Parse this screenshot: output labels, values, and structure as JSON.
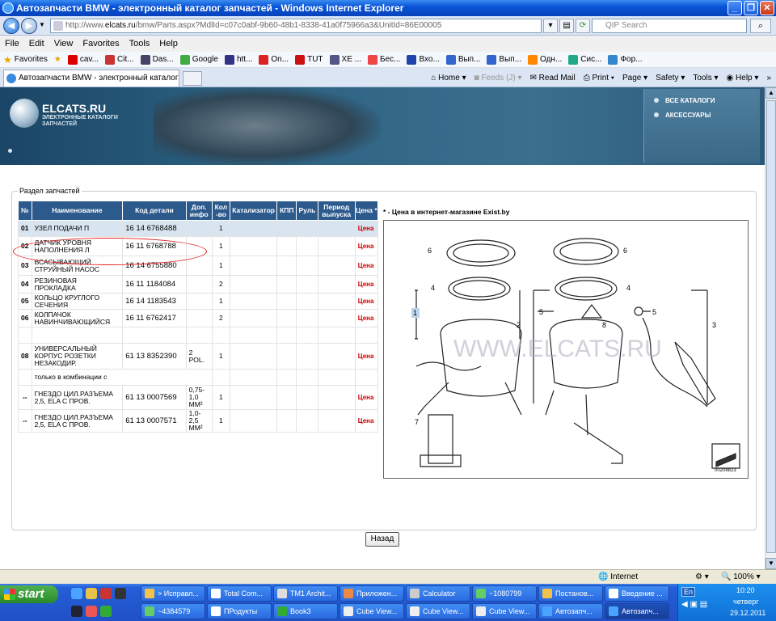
{
  "window": {
    "title": "Автозапчасти BMW - электронный каталог запчастей - Windows Internet Explorer"
  },
  "address": {
    "url_prefix": "http://www.",
    "url_domain": "elcats.ru",
    "url_rest": "/bmw/Parts.aspx?MdlId=c07c0abf-9b60-48b1-8338-41a0f75966a3&UnitId=86E00005",
    "search_placeholder": "QIP Search"
  },
  "menu": [
    "File",
    "Edit",
    "View",
    "Favorites",
    "Tools",
    "Help"
  ],
  "favorites": {
    "label": "Favorites",
    "items": [
      "cav...",
      "Cit...",
      "Das...",
      "Google",
      "htt...",
      "On...",
      "TUT",
      "XE ...",
      "Бес...",
      "Вхо...",
      "Вып...",
      "Вып...",
      "Одн...",
      "Сис...",
      "Фор..."
    ]
  },
  "tab": {
    "label": "Автозапчасти BMW - электронный каталог запчас..."
  },
  "commands": {
    "home": "Home",
    "feeds": "Feeds (J)",
    "mail": "Read Mail",
    "print": "Print",
    "page": "Page",
    "safety": "Safety",
    "tools": "Tools",
    "help": "Help"
  },
  "banner": {
    "logo": "ELCATS.RU",
    "logo_sub": "ЭЛЕКТРОННЫЕ КАТАЛОГИ ЗАПЧАСТЕЙ",
    "link_all": "ВСЕ КАТАЛОГИ",
    "link_acc": "АКСЕССУАРЫ"
  },
  "section": {
    "legend": "Раздел запчастей",
    "note": "* - Цена в интернет-магазине Exist.by",
    "back": "Назад"
  },
  "table": {
    "headers": [
      "№",
      "Наименование",
      "Код детали",
      "Доп. инфо",
      "Кол -во",
      "Катализатор",
      "КПП",
      "Руль",
      "Период выпуска",
      "Цена *"
    ],
    "rows": [
      {
        "num": "01",
        "name": "УЗЕЛ ПОДАЧИ П",
        "code": "16 14 6768488",
        "info": "",
        "qty": "1",
        "price": "Цена"
      },
      {
        "num": "02",
        "name": "ДАТЧИК УРОВНЯ НАПОЛНЕНИЯ Л",
        "code": "16 11 6768788",
        "info": "",
        "qty": "1",
        "price": "Цена"
      },
      {
        "num": "03",
        "name": "ВСАСЫВАЮЩИЙ СТРУЙНЫЙ НАСОС",
        "code": "16 14 6755880",
        "info": "",
        "qty": "1",
        "price": "Цена"
      },
      {
        "num": "04",
        "name": "РЕЗИНОВАЯ ПРОКЛАДКА",
        "code": "16 11 1184084",
        "info": "",
        "qty": "2",
        "price": "Цена"
      },
      {
        "num": "05",
        "name": "КОЛЬЦО КРУГЛОГО СЕЧЕНИЯ",
        "code": "16 14 1183543",
        "info": "",
        "qty": "1",
        "price": "Цена"
      },
      {
        "num": "06",
        "name": "КОЛПАЧОК НАВИНЧИВАЮЩИЙСЯ",
        "code": "16 11 6762417",
        "info": "",
        "qty": "2",
        "price": "Цена"
      },
      {
        "num": "",
        "name": "",
        "code": "",
        "info": "",
        "qty": "",
        "price": ""
      },
      {
        "num": "08",
        "name": "УНИВЕРСАЛЬНЫЙ КОРПУС РОЗЕТКИ НЕЗАКОДИР.",
        "code": "61 13 8352390",
        "info": "2 POL.",
        "qty": "1",
        "price": "Цена"
      },
      {
        "num": "",
        "name": "только в комбинации с",
        "code": "",
        "info": "",
        "qty": "",
        "price": ""
      },
      {
        "num": "--",
        "name": "ГНЕЗДО ЦИЛ.РАЗЪЕМА 2,5, ELA С ПРОВ.",
        "code": "61 13 0007569",
        "info": "0,75-1,0 MM²",
        "qty": "1",
        "price": "Цена"
      },
      {
        "num": "--",
        "name": "ГНЕЗДО ЦИЛ.РАЗЪЕМА 2,5, ELA С ПРОВ.",
        "code": "61 13 0007571",
        "info": "1,0-2,5 MM²",
        "qty": "1",
        "price": "Цена"
      }
    ]
  },
  "diagram": {
    "watermark": "WWW.ELCATS.RU",
    "labels": [
      "6",
      "6",
      "4",
      "4",
      "1",
      "5",
      "5",
      "2",
      "8",
      "3",
      "7"
    ],
    "code": "00208823"
  },
  "status": {
    "zone": "Internet",
    "zoom": "100%"
  },
  "taskbar": {
    "start": "start",
    "row1": [
      "> Исправл...",
      "Total Com...",
      "TM1 Archit...",
      "Приложен...",
      "Calculator",
      "~1080799",
      "Постанов...",
      "Введение ..."
    ],
    "row2": [
      "~4384579",
      "ПРодукты",
      "Book3",
      "Cube View...",
      "Cube View...",
      "Cube View...",
      "Автозапч...",
      "Автозапч..."
    ],
    "lang": "En",
    "time": "10:20",
    "day": "четверг",
    "date": "29.12.2011"
  }
}
